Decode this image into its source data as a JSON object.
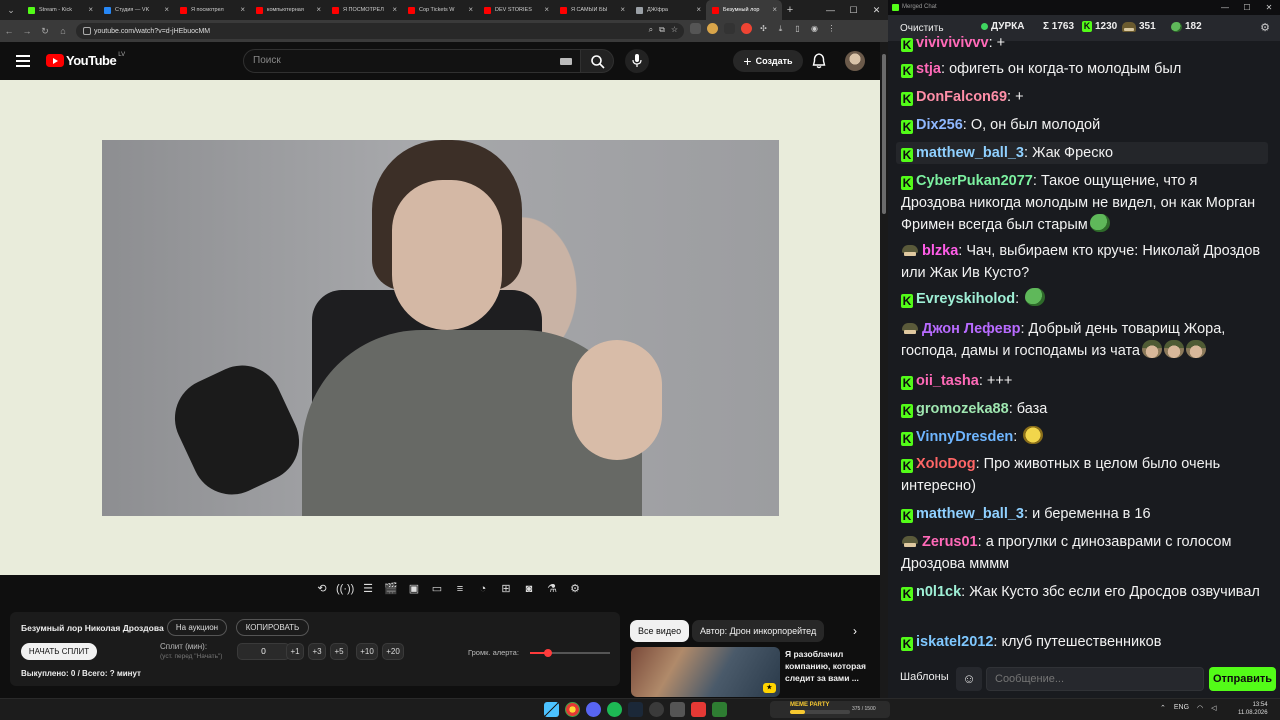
{
  "browser": {
    "tabs": [
      {
        "title": "Stream - Kick",
        "fav": "kick"
      },
      {
        "title": "Студия — VK",
        "fav": "vk"
      },
      {
        "title": "Я посмотрел",
        "fav": "yt"
      },
      {
        "title": "компьютерная",
        "fav": "yt"
      },
      {
        "title": "Я ПОСМОТРЕЛ",
        "fav": "yt"
      },
      {
        "title": "Cop Tickets W",
        "fav": "yt"
      },
      {
        "title": "DEV STORIES",
        "fav": "yt"
      },
      {
        "title": "Я САМЫЙ БЫ",
        "fav": "yt"
      },
      {
        "title": "ДЖ/фра",
        "fav": "gray"
      },
      {
        "title": "Безумный лор",
        "fav": "yt"
      }
    ],
    "active_tab": 9,
    "url": "youtube.com/watch?v=d-jHEbuocMM"
  },
  "youtube": {
    "logo_text": "YouTube",
    "region": "LV",
    "search_placeholder": "Поиск",
    "create_label": "Создать"
  },
  "panel": {
    "title": "Безумный лор Николая Дроздова",
    "auction_label": "На аукцион",
    "copy_label": "КОПИРОВАТЬ",
    "start_split_label": "НАЧАТЬ СПЛИТ",
    "split_label": "Сплит (мин):",
    "split_hint": "(уст. перед \"Начать\")",
    "split_value": "0",
    "steps": [
      "+1",
      "+3",
      "+5",
      "+10",
      "+20"
    ],
    "volume_label": "Громк. алерта:",
    "volume_fraction": 0.22,
    "bought_label": "Выкуплено: 0 / Всего: ? минут"
  },
  "recommendations": {
    "chips": [
      "Все видео",
      "Автор: Дрон инкорпорейтед"
    ],
    "video_title": "Я разоблачил компанию, которая следит за вами ..."
  },
  "chat": {
    "window_title": "Merged Chat",
    "clear_label": "Очистить",
    "channel_name": "ДУРКА",
    "total": "Σ 1763",
    "kick_count": "1230",
    "hat_count": "351",
    "frog_count": "182",
    "messages": [
      {
        "badge": "k",
        "user": "vivivivivvv",
        "color": "#ff6ab8",
        "text": "+",
        "emotes": []
      },
      {
        "badge": "k",
        "user": "stja",
        "color": "#ff6ab8",
        "text": "офигеть он когда-то молодым был",
        "emotes": []
      },
      {
        "badge": "k",
        "user": "DonFalcon69",
        "color": "#ff8fa8",
        "text": "+",
        "emotes": []
      },
      {
        "badge": "k",
        "user": "Dix256",
        "color": "#8fb8ff",
        "text": "О, он был молодой",
        "emotes": []
      },
      {
        "badge": "k",
        "user": "matthew_ball_3",
        "color": "#8fd0ff",
        "text": "Жак Фреско",
        "emotes": []
      },
      {
        "badge": "k",
        "user": "CyberPukan2077",
        "color": "#7cf0a0",
        "text": "Такое ощущение, что я Дроздова никогда молодым не видел, он как Морган Фримен всегда был старым",
        "emotes": [
          "frog"
        ]
      },
      {
        "badge": "hat",
        "user": "blzka",
        "color": "#ff5de8",
        "text": "Чач, выбираем кто круче: Николай Дроздов или Жак Ив Кусто?",
        "emotes": []
      },
      {
        "badge": "k",
        "user": "Evreyskiholod",
        "color": "#9ff0d6",
        "text": "",
        "emotes": [
          "frog"
        ]
      },
      {
        "badge": "hat",
        "user": "Джон Лефевр",
        "color": "#b86bff",
        "text": "Добрый день товарищ Жора, господа, дамы и господамы из чата",
        "emotes": [
          "hatface",
          "hatface",
          "hatface"
        ]
      },
      {
        "badge": "k",
        "user": "oii_tasha",
        "color": "#ff6ab8",
        "text": "+++",
        "emotes": []
      },
      {
        "badge": "k",
        "user": "gromozeka88",
        "color": "#9fe6b0",
        "text": "база",
        "emotes": []
      },
      {
        "badge": "k",
        "user": "VinnyDresden",
        "color": "#6fb6ff",
        "text": "",
        "emotes": [
          "yellow"
        ]
      },
      {
        "badge": "k",
        "user": "XoloDog",
        "color": "#ff6666",
        "text": "Про животных в целом было очень интересно)",
        "emotes": []
      },
      {
        "badge": "k",
        "user": "matthew_ball_3",
        "color": "#8fd0ff",
        "text": "и беременна в 16",
        "emotes": []
      },
      {
        "badge": "hat",
        "user": "Zerus01",
        "color": "#ff6ab8",
        "text": "а прогулки с динозаврами с голосом Дроздова мммм",
        "emotes": []
      },
      {
        "badge": "k",
        "user": "n0l1ck",
        "color": "#9ff0d6",
        "text": "Жак Кусто збс если его Дросдов озвучивал",
        "emotes": []
      },
      {
        "badge": "k",
        "user": "iskatel2012",
        "color": "#7fc8ff",
        "text": "клуб путешественников",
        "emotes": []
      }
    ],
    "templates_label": "Шаблоны",
    "input_placeholder": "Сообщение...",
    "send_label": "Отправить"
  },
  "taskbar": {
    "widget_label": "MEME PARTY",
    "widget_count": "375 / 1500",
    "widget_fraction": 0.25,
    "lang": "ENG",
    "time": "13:54",
    "date": "11.08.2026"
  },
  "colors": {
    "kick_green": "#53fc18",
    "youtube_red": "#ff0000",
    "video_bg": "#e9ecdb",
    "chat_bg": "#191b1f"
  }
}
